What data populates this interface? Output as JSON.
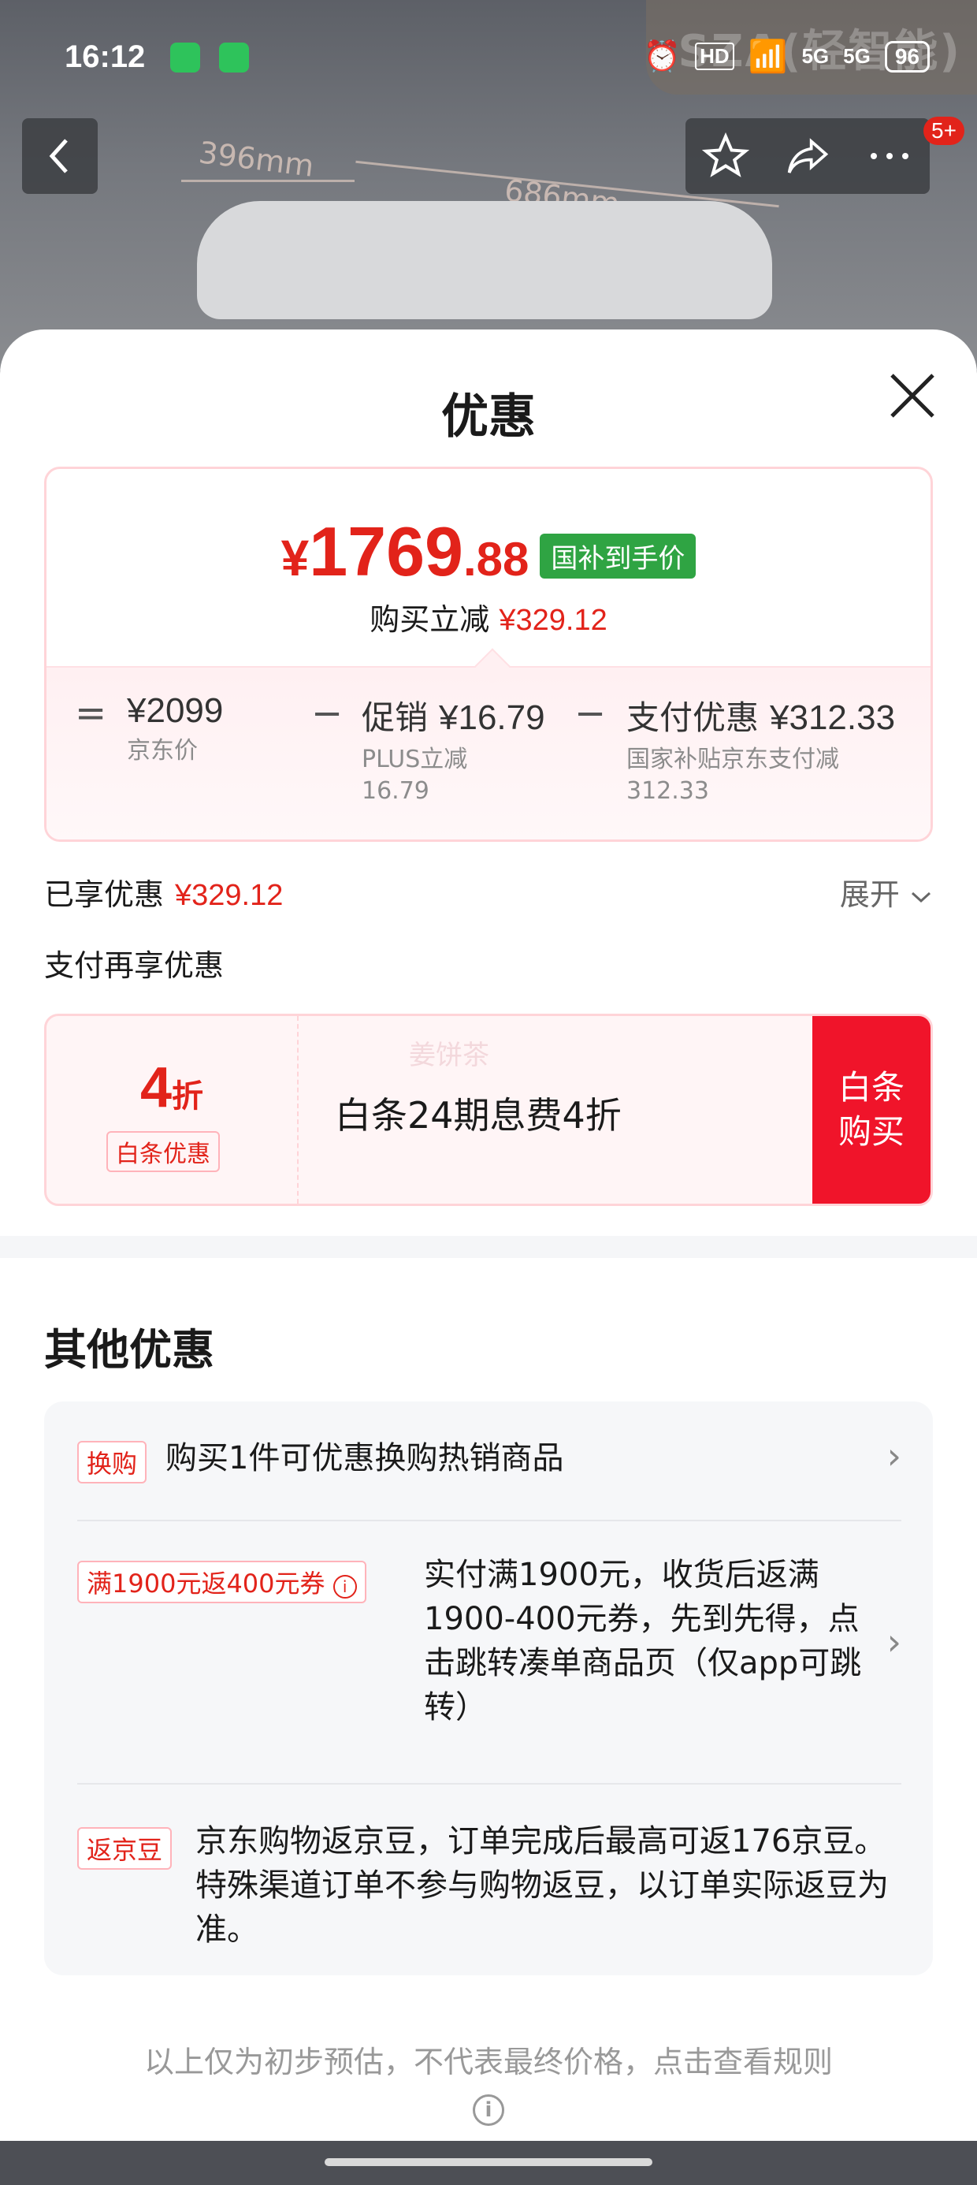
{
  "status_bar": {
    "time": "16:12",
    "network": "5G",
    "hd": "HD",
    "battery": "96"
  },
  "background": {
    "brand_text": "SZA(轻智能)",
    "dim1": "396mm",
    "dim2": "686mm"
  },
  "nav": {
    "badge": "5+"
  },
  "sheet": {
    "title": "优惠",
    "price": {
      "yen": "¥",
      "int": "1769",
      "dec": ".88",
      "tag": "国补到手价"
    },
    "reduce": {
      "label": "购买立减",
      "value": "¥329.12"
    },
    "breakdown": {
      "eq": "=",
      "jd_price": {
        "value": "¥2099",
        "sub": "京东价"
      },
      "minus": "−",
      "promo": {
        "label": "促销",
        "value": "¥16.79",
        "sub": "PLUS立减16.79"
      },
      "pay": {
        "label": "支付优惠",
        "value": "¥312.33",
        "sub": "国家补贴京东支付减312.33"
      }
    },
    "enjoyed": {
      "label": "已享优惠",
      "value": "¥329.12"
    },
    "expand": "展开",
    "pay_more": "支付再享优惠",
    "baitiao": {
      "discount_num": "4",
      "discount_unit": "折",
      "tag": "白条优惠",
      "text": "白条24期息费4折",
      "watermark": "姜饼茶",
      "buy_line1": "白条",
      "buy_line2": "购买"
    },
    "other_title": "其他优惠",
    "others": [
      {
        "tag": "换购",
        "text": "购买1件可优惠换购热销商品"
      },
      {
        "tag": "满1900元返400元券",
        "text": "实付满1900元，收货后返满1900-400元券，先到先得，点击跳转凑单商品页（仅app可跳转）"
      },
      {
        "tag": "返京豆",
        "text": "京东购物返京豆，订单完成后最高可返176京豆。特殊渠道订单不参与购物返豆，以订单实际返豆为准。"
      }
    ],
    "footnote": "以上仅为初步预估，不代表最终价格，点击查看规则"
  }
}
